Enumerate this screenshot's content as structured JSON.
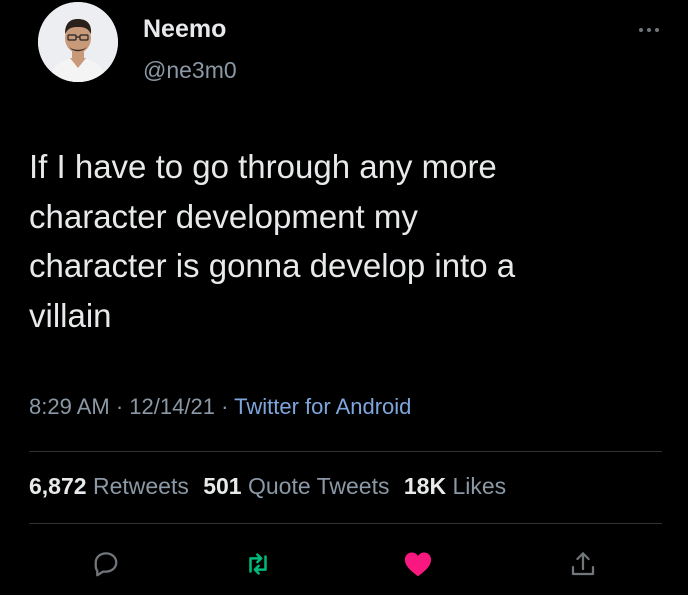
{
  "user": {
    "display_name": "Neemo",
    "handle": "@ne3m0"
  },
  "tweet": {
    "text": "If I have to go through any more\ncharacter development my\ncharacter is gonna develop into a\nvillain",
    "time": "8:29 AM",
    "date": "12/14/21",
    "separator": "·",
    "source": "Twitter for Android"
  },
  "stats": {
    "retweets_count": "6,872",
    "retweets_label": "Retweets",
    "quotes_count": "501",
    "quotes_label": "Quote Tweets",
    "likes_count": "18K",
    "likes_label": "Likes"
  },
  "actions": {
    "reply_icon": "reply-icon",
    "retweet_icon": "retweet-icon",
    "like_icon": "heart-icon",
    "share_icon": "share-icon"
  },
  "colors": {
    "background": "#000000",
    "text": "#e7e9ea",
    "secondary": "#8b98a5",
    "link": "#7ea6dd",
    "retweet": "#00ba7c",
    "like": "#f91880"
  }
}
